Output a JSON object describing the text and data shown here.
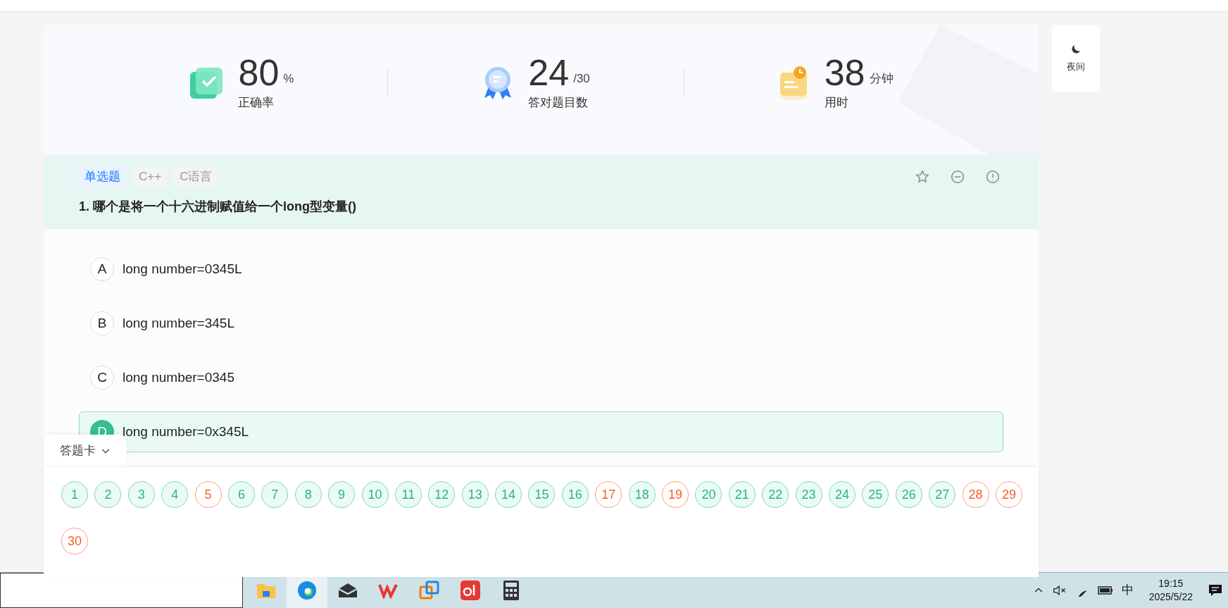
{
  "stats": [
    {
      "kind": "accuracy",
      "value": "80",
      "unit": "%",
      "label": "正确率"
    },
    {
      "kind": "correct",
      "value": "24",
      "unit": "/30",
      "label": "答对题目数"
    },
    {
      "kind": "time",
      "value": "38",
      "unit": "分钟",
      "label": "用时"
    }
  ],
  "night_button": {
    "label": "夜间"
  },
  "question": {
    "tags": [
      {
        "label": "单选题",
        "kind": "type"
      },
      {
        "label": "C++",
        "kind": "topic"
      },
      {
        "label": "C语言",
        "kind": "topic"
      }
    ],
    "title": "1. 哪个是将一个十六进制赋值给一个long型变量()",
    "options": [
      {
        "letter": "A",
        "text": "long number=0345L",
        "selected": false
      },
      {
        "letter": "B",
        "text": "long number=345L",
        "selected": false
      },
      {
        "letter": "C",
        "text": "long number=0345",
        "selected": false
      },
      {
        "letter": "D",
        "text": "long number=0x345L",
        "selected": true
      }
    ]
  },
  "answer_card": {
    "title": "答题卡",
    "items": [
      {
        "number": "1",
        "kind": "correct"
      },
      {
        "number": "2",
        "kind": "correct"
      },
      {
        "number": "3",
        "kind": "correct"
      },
      {
        "number": "4",
        "kind": "correct"
      },
      {
        "number": "5",
        "kind": "wrong"
      },
      {
        "number": "6",
        "kind": "correct"
      },
      {
        "number": "7",
        "kind": "correct"
      },
      {
        "number": "8",
        "kind": "correct"
      },
      {
        "number": "9",
        "kind": "correct"
      },
      {
        "number": "10",
        "kind": "correct"
      },
      {
        "number": "11",
        "kind": "correct"
      },
      {
        "number": "12",
        "kind": "correct"
      },
      {
        "number": "13",
        "kind": "correct"
      },
      {
        "number": "14",
        "kind": "correct"
      },
      {
        "number": "15",
        "kind": "correct"
      },
      {
        "number": "16",
        "kind": "correct"
      },
      {
        "number": "17",
        "kind": "wrong"
      },
      {
        "number": "18",
        "kind": "correct"
      },
      {
        "number": "19",
        "kind": "wrong"
      },
      {
        "number": "20",
        "kind": "correct"
      },
      {
        "number": "21",
        "kind": "correct"
      },
      {
        "number": "22",
        "kind": "correct"
      },
      {
        "number": "23",
        "kind": "correct"
      },
      {
        "number": "24",
        "kind": "correct"
      },
      {
        "number": "25",
        "kind": "correct"
      },
      {
        "number": "26",
        "kind": "correct"
      },
      {
        "number": "27",
        "kind": "correct"
      },
      {
        "number": "28",
        "kind": "wrong"
      },
      {
        "number": "29",
        "kind": "wrong"
      },
      {
        "number": "30",
        "kind": "wrong"
      }
    ]
  },
  "taskbar": {
    "ime": "中",
    "time": "19:15",
    "date": "2025/5/22"
  }
}
